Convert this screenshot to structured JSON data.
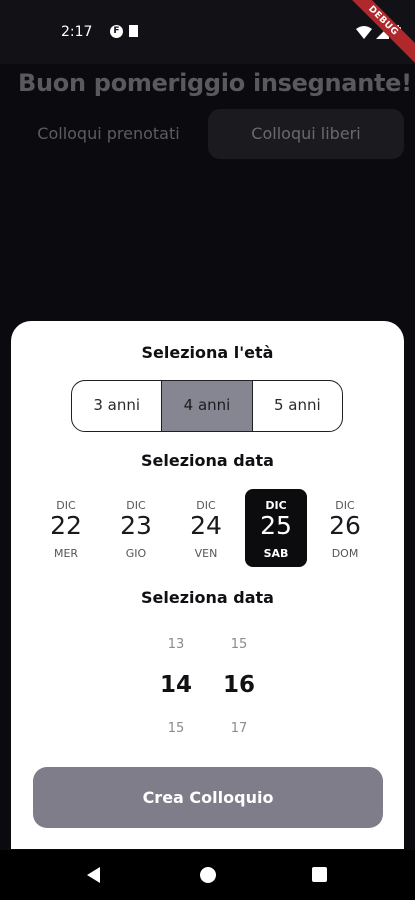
{
  "status_bar": {
    "time": "2:17",
    "notification_icons": [
      "f-app-icon",
      "sd-card-icon"
    ],
    "right_icons": [
      "wifi-icon",
      "signal-icon",
      "battery-icon"
    ],
    "debug_banner": "DEBUG"
  },
  "header": {
    "greeting": "Buon pomeriggio insegnante!"
  },
  "tabs": [
    {
      "label": "Colloqui prenotati",
      "selected": false
    },
    {
      "label": "Colloqui liberi",
      "selected": true
    }
  ],
  "sheet": {
    "age_title": "Seleziona l'età",
    "age_options": [
      {
        "label": "3 anni",
        "selected": false
      },
      {
        "label": "4 anni",
        "selected": true
      },
      {
        "label": "5 anni",
        "selected": false
      }
    ],
    "date_title": "Seleziona data",
    "dates": [
      {
        "month": "DIC",
        "day": "22",
        "weekday": "MER",
        "selected": false
      },
      {
        "month": "DIC",
        "day": "23",
        "weekday": "GIO",
        "selected": false
      },
      {
        "month": "DIC",
        "day": "24",
        "weekday": "VEN",
        "selected": false
      },
      {
        "month": "DIC",
        "day": "25",
        "weekday": "SAB",
        "selected": true
      },
      {
        "month": "DIC",
        "day": "26",
        "weekday": "DOM",
        "selected": false
      }
    ],
    "time_title": "Seleziona data",
    "hour_picker": {
      "prev": "13",
      "current": "14",
      "next": "15"
    },
    "minute_picker": {
      "prev": "15",
      "current": "16",
      "next": "17"
    },
    "create_button": "Crea Colloquio"
  },
  "nav_bar": {
    "buttons": [
      "back-icon",
      "home-icon",
      "recents-icon"
    ]
  },
  "colors": {
    "background": "#0b0a0e",
    "selected_segment": "#868592",
    "selected_date": "#0c0c0f",
    "button": "#7e7d89"
  }
}
